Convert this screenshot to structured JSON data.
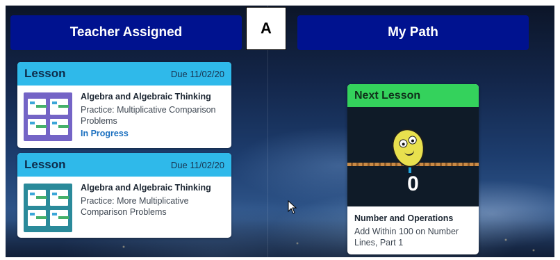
{
  "tabs": {
    "teacher_assigned": "Teacher Assigned",
    "my_path": "My Path"
  },
  "annotation_letter": "A",
  "assigned_lessons": [
    {
      "type": "Lesson",
      "due": "Due 11/02/20",
      "subject": "Algebra and Algebraic Thinking",
      "description": "Practice: Multiplicative Comparison Problems",
      "status": "In Progress"
    },
    {
      "type": "Lesson",
      "due": "Due 11/02/20",
      "subject": "Algebra and Algebraic Thinking",
      "description": "Practice: More Multiplicative Comparison Problems",
      "status": ""
    }
  ],
  "next_lesson": {
    "header": "Next Lesson",
    "counter": "0",
    "subject": "Number and Operations",
    "description": "Add Within 100 on Number Lines, Part 1"
  },
  "colors": {
    "tab_bg": "#00128f",
    "lesson_header": "#2fb9ea",
    "next_header": "#34d25c",
    "status_link": "#1a6fbf"
  },
  "icons": {
    "cursor": "mouse-pointer-icon",
    "mascot": "bean-mascot-icon"
  }
}
